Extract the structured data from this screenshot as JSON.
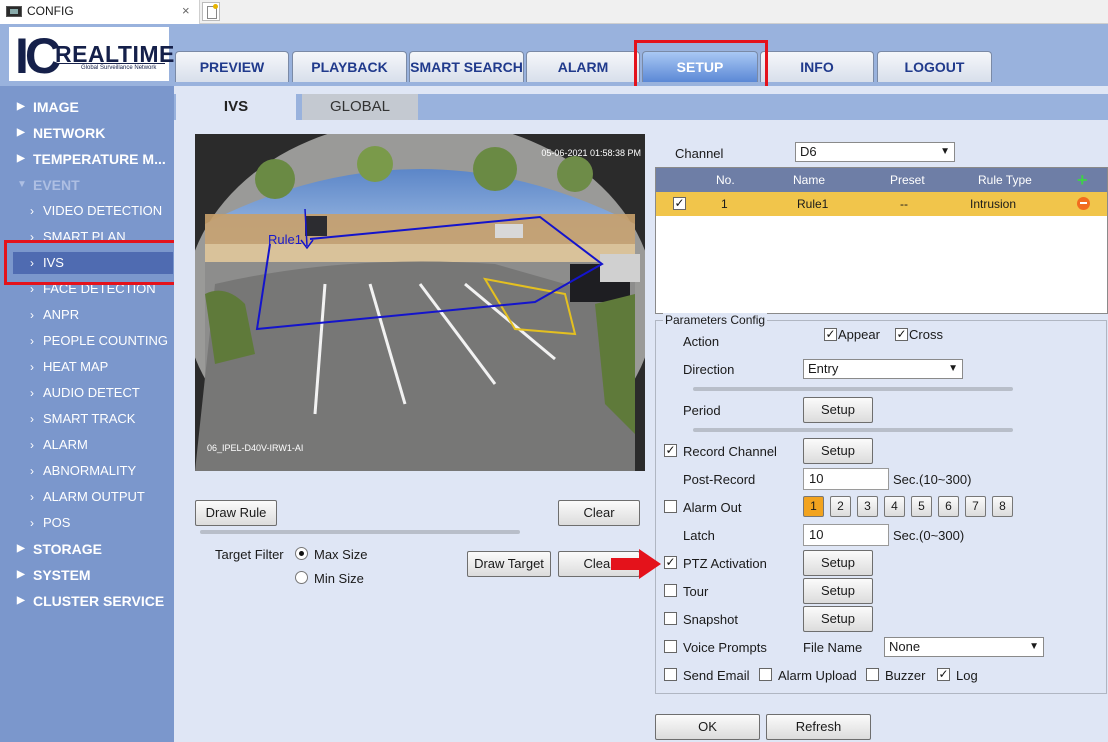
{
  "browser": {
    "tab_title": "CONFIG",
    "close_glyph": "×"
  },
  "logo": {
    "ic": "IC",
    "brand": "REALTIME",
    "tagline": "Global Surveillance Network"
  },
  "nav": {
    "tabs": [
      {
        "label": "PREVIEW"
      },
      {
        "label": "PLAYBACK"
      },
      {
        "label": "SMART SEARCH"
      },
      {
        "label": "ALARM"
      },
      {
        "label": "SETUP",
        "active": true
      },
      {
        "label": "INFO"
      },
      {
        "label": "LOGOUT"
      }
    ]
  },
  "sidebar": {
    "top": [
      {
        "label": "IMAGE"
      },
      {
        "label": "NETWORK"
      },
      {
        "label": "TEMPERATURE M..."
      },
      {
        "label": "EVENT",
        "expanded": true
      }
    ],
    "event_items": [
      {
        "label": "VIDEO DETECTION"
      },
      {
        "label": "SMART PLAN"
      },
      {
        "label": "IVS",
        "active": true
      },
      {
        "label": "FACE DETECTION"
      },
      {
        "label": "ANPR"
      },
      {
        "label": "PEOPLE COUNTING"
      },
      {
        "label": "HEAT MAP"
      },
      {
        "label": "AUDIO DETECT"
      },
      {
        "label": "SMART TRACK"
      },
      {
        "label": "ALARM"
      },
      {
        "label": "ABNORMALITY"
      },
      {
        "label": "ALARM OUTPUT"
      },
      {
        "label": "POS"
      }
    ],
    "bottom": [
      {
        "label": "STORAGE"
      },
      {
        "label": "SYSTEM"
      },
      {
        "label": "CLUSTER SERVICE"
      }
    ]
  },
  "subtabs": {
    "ivs": "IVS",
    "global": "GLOBAL"
  },
  "video": {
    "timestamp": "05-06-2021 01:58:38 PM",
    "camera_name": "06_IPEL-D40V-IRW1-AI",
    "rule_label": "Rule1"
  },
  "buttons": {
    "draw_rule": "Draw Rule",
    "clear_rule": "Clear",
    "draw_target": "Draw Target",
    "clear_target": "Clear",
    "ok": "OK",
    "refresh": "Refresh"
  },
  "target_filter": {
    "label": "Target Filter",
    "max": "Max Size",
    "min": "Min Size",
    "selected": "max"
  },
  "channel": {
    "label": "Channel",
    "value": "D6"
  },
  "rules_table": {
    "headers": [
      "No.",
      "Name",
      "Preset",
      "Rule Type"
    ],
    "rows": [
      {
        "checked": true,
        "no": "1",
        "name": "Rule1",
        "preset": "--",
        "type": "Intrusion"
      }
    ]
  },
  "params": {
    "title": "Parameters Config",
    "action_label": "Action",
    "appear": "Appear",
    "cross": "Cross",
    "direction_label": "Direction",
    "direction_value": "Entry",
    "period_label": "Period",
    "setup": "Setup",
    "record_channel": "Record Channel",
    "post_record": "Post-Record",
    "post_record_value": "10",
    "post_record_unit": "Sec.(10~300)",
    "alarm_out": "Alarm Out",
    "alarm_out_numbers": [
      "1",
      "2",
      "3",
      "4",
      "5",
      "6",
      "7",
      "8"
    ],
    "latch": "Latch",
    "latch_value": "10",
    "latch_unit": "Sec.(0~300)",
    "ptz_activation": "PTZ Activation",
    "tour": "Tour",
    "snapshot": "Snapshot",
    "voice_prompts": "Voice Prompts",
    "file_name_label": "File Name",
    "file_name_value": "None",
    "send_email": "Send Email",
    "alarm_upload": "Alarm Upload",
    "buzzer": "Buzzer",
    "log": "Log"
  },
  "colors": {
    "highlight": "#e4121b",
    "accent": "#4f6bb1",
    "selected_row": "#f1c54b"
  }
}
